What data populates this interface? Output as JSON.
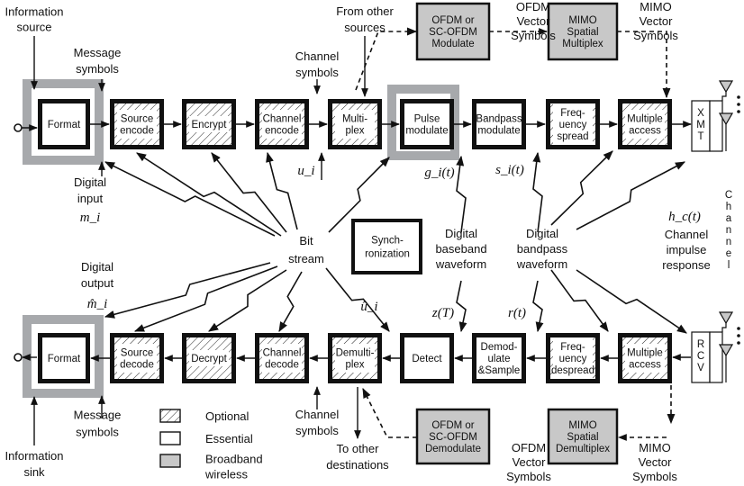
{
  "colors": {
    "ink": "#111111",
    "broadband_gray": "#c8c8c8",
    "frame_gray": "#a7a9ac",
    "paper": "#ffffff"
  },
  "blocks": {
    "top": [
      {
        "lines": [
          "Format"
        ],
        "type": "essential",
        "broadband_frame": true
      },
      {
        "lines": [
          "Source",
          "encode"
        ],
        "type": "optional"
      },
      {
        "lines": [
          "Encrypt"
        ],
        "type": "optional"
      },
      {
        "lines": [
          "Channel",
          "encode"
        ],
        "type": "optional"
      },
      {
        "lines": [
          "Multi-",
          "plex"
        ],
        "type": "optional"
      },
      {
        "lines": [
          "Pulse",
          "modulate"
        ],
        "type": "essential",
        "broadband_frame": true
      },
      {
        "lines": [
          "Bandpass",
          "modulate"
        ],
        "type": "essential"
      },
      {
        "lines": [
          "Freq-",
          "uency",
          "spread"
        ],
        "type": "optional"
      },
      {
        "lines": [
          "Multiple",
          "access"
        ],
        "type": "optional"
      }
    ],
    "bottom": [
      {
        "lines": [
          "Format"
        ],
        "type": "essential",
        "broadband_frame": true
      },
      {
        "lines": [
          "Source",
          "decode"
        ],
        "type": "optional"
      },
      {
        "lines": [
          "Decrypt"
        ],
        "type": "optional"
      },
      {
        "lines": [
          "Channel",
          "decode"
        ],
        "type": "optional"
      },
      {
        "lines": [
          "Demulti-",
          "plex"
        ],
        "type": "optional"
      },
      {
        "lines": [
          "Detect"
        ],
        "type": "essential"
      },
      {
        "lines": [
          "Demod-",
          "ulate",
          "&Sample"
        ],
        "type": "essential"
      },
      {
        "lines": [
          "Freq-",
          "uency",
          "despread"
        ],
        "type": "optional"
      },
      {
        "lines": [
          "Multiple",
          "access"
        ],
        "type": "optional"
      }
    ]
  },
  "vector_blocks": {
    "top": [
      {
        "lines": [
          "OFDM or",
          "SC-OFDM",
          "Modulate"
        ]
      },
      {
        "lines": [
          "MIMO",
          "Spatial",
          "Multiplex"
        ]
      }
    ],
    "bottom": [
      {
        "lines": [
          "OFDM or",
          "SC-OFDM",
          "Demodulate"
        ]
      },
      {
        "lines": [
          "MIMO",
          "Spatial",
          "Demultiplex"
        ]
      }
    ]
  },
  "tx_unit": [
    "X",
    "M",
    "T"
  ],
  "rx_unit": [
    "R",
    "C",
    "V"
  ],
  "sync_block": [
    "Synch-",
    "ronization"
  ],
  "annotations": {
    "information_source": [
      "Information",
      "source"
    ],
    "message_symbols_top": [
      "Message",
      "symbols"
    ],
    "digital_input": [
      "Digital",
      "input"
    ],
    "digital_input_symbol": "m_i",
    "channel_symbols_top": [
      "Channel",
      "symbols"
    ],
    "from_other_sources": [
      "From other",
      "sources"
    ],
    "ofdm_vector_symbols_top": [
      "OFDM",
      "Vector",
      "Symbols"
    ],
    "mimo_vector_symbols_top": [
      "MIMO",
      "Vector",
      "Symbols"
    ],
    "u_i": "u_i",
    "g_i": "g_i(t)",
    "s_i": "s_i(t)",
    "bit_stream": [
      "Bit",
      "stream"
    ],
    "digital_baseband_waveform": [
      "Digital",
      "baseband",
      "waveform"
    ],
    "digital_bandpass_waveform": [
      "Digital",
      "bandpass",
      "waveform"
    ],
    "h_c": "h_c(t)",
    "channel_impulse_response": [
      "Channel",
      "impulse",
      "response"
    ],
    "channel_vertical": [
      "C",
      "h",
      "a",
      "n",
      "n",
      "e",
      "l"
    ],
    "digital_output": [
      "Digital",
      "output"
    ],
    "digital_output_symbol": "m̂_i",
    "u_hat_i": "û_i",
    "z_T": "z(T)",
    "r_t": "r(t)",
    "message_symbols_bottom": [
      "Message",
      "symbols"
    ],
    "information_sink": [
      "Information",
      "sink"
    ],
    "channel_symbols_bottom": [
      "Channel",
      "symbols"
    ],
    "to_other_destinations": [
      "To other",
      "destinations"
    ],
    "ofdm_vector_symbols_bottom": [
      "OFDM",
      "Vector",
      "Symbols"
    ],
    "mimo_vector_symbols_bottom": [
      "MIMO",
      "Vector",
      "Symbols"
    ]
  },
  "legend": [
    {
      "label": "Optional",
      "type": "optional"
    },
    {
      "label": "Essential",
      "type": "essential"
    },
    {
      "label": "Broadband wireless",
      "lines": [
        "Broadband",
        "wireless"
      ],
      "type": "broadband"
    }
  ]
}
